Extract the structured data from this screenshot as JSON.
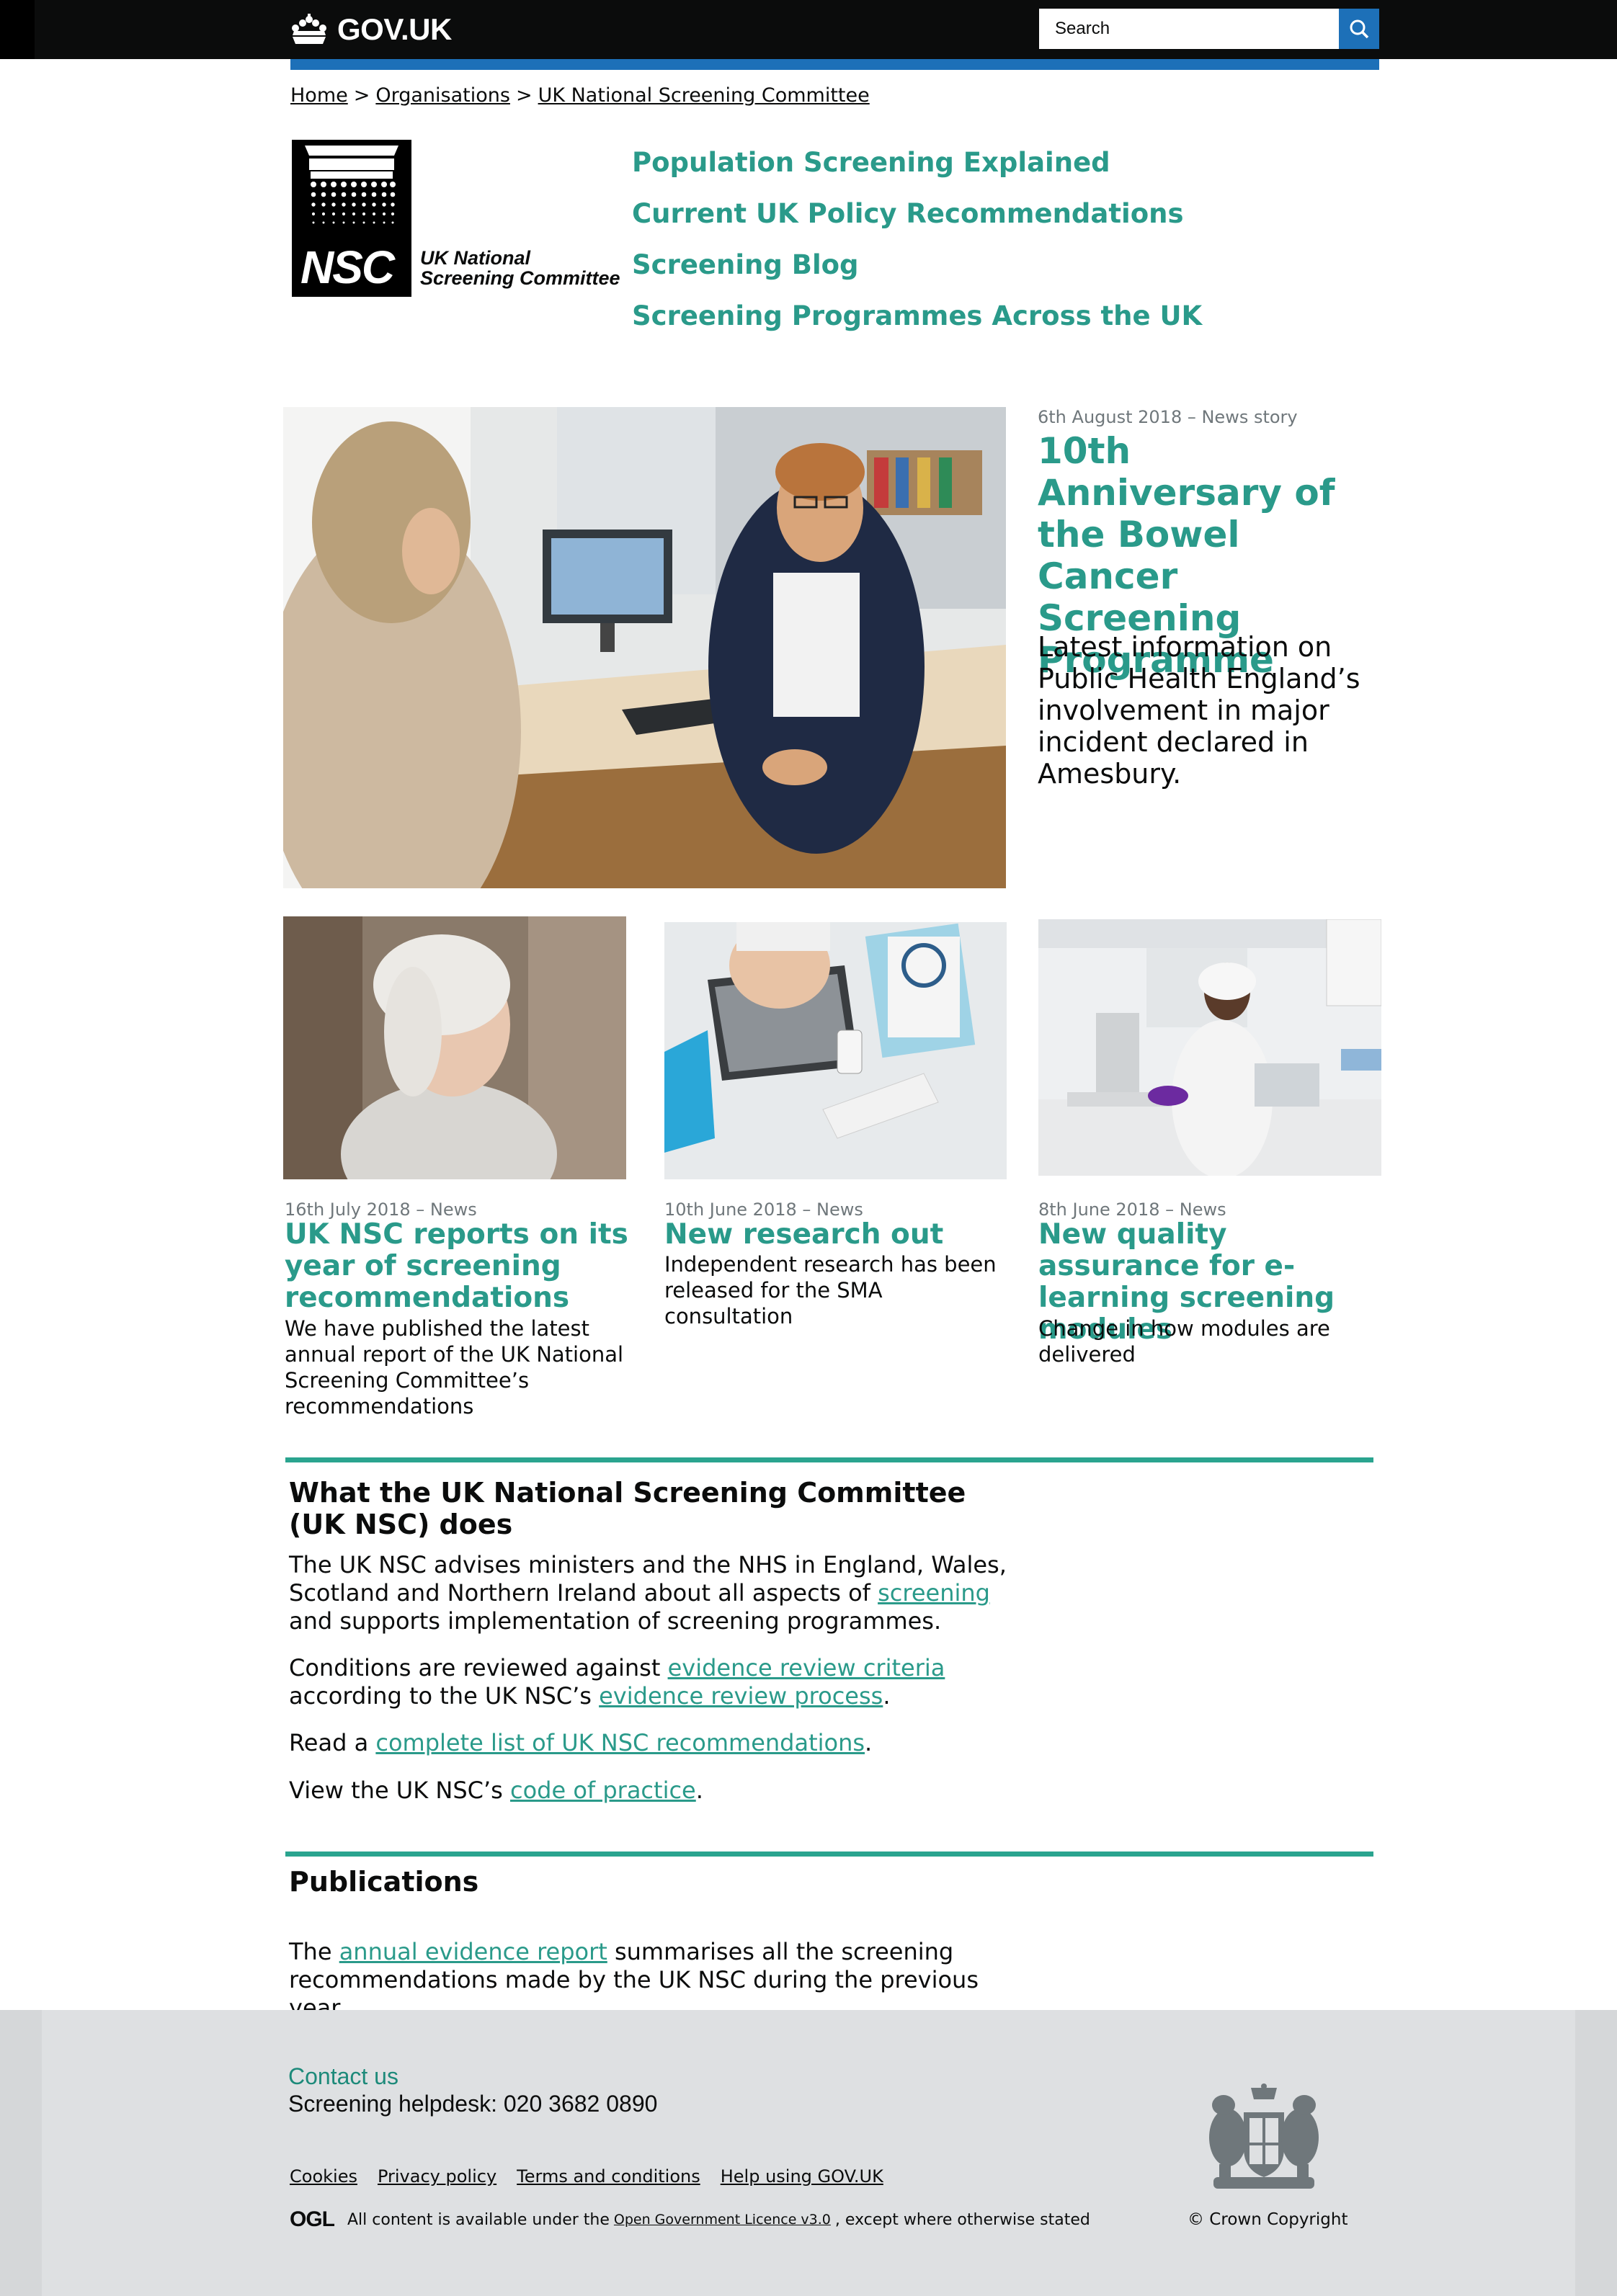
{
  "header": {
    "logo_text": "GOV.UK",
    "search_placeholder": "Search"
  },
  "breadcrumb": {
    "items": [
      "Home",
      "Organisations",
      "UK National Screening Committee"
    ],
    "separator": ">"
  },
  "nsc_logo": {
    "letters": "NSC",
    "line1": "UK National",
    "line2": "Screening Committee"
  },
  "top_nav": [
    "Population Screening Explained",
    "Current UK Policy Recommendations",
    "Screening Blog",
    "Screening Programmes Across the UK"
  ],
  "hero": {
    "meta": "6th August 2018 – News story",
    "title": "10th Anniversary of the Bowel Cancer Screening Programme",
    "description": "Latest information on Public Health England’s involvement in major incident declared in Amesbury."
  },
  "cards": [
    {
      "meta": "16th July 2018 – News",
      "title": "UK NSC reports on its year of screening recommendations",
      "description": "We have published the latest annual report of the UK National Screening Committee’s recommendations"
    },
    {
      "meta": "10th June 2018 – News",
      "title": "New research out",
      "description": "Independent research has been released for the SMA consultation"
    },
    {
      "meta": "8th June 2018 – News",
      "title": "New quality assurance for e-learning screening modules",
      "description": "Change in how modules are delivered"
    }
  ],
  "about": {
    "title": "What the UK National Screening Committee (UK NSC) does",
    "p1_before": "The UK NSC advises ministers and the NHS in England, Wales, Scotland and Northern Ireland about all aspects of ",
    "p1_link": "screening",
    "p1_after": " and supports implementation of screening programmes.",
    "p2_before": "Conditions are reviewed against ",
    "p2_link1": "evidence review criteria",
    "p2_middle": " according to the UK NSC’s ",
    "p2_link2": "evidence review process",
    "p2_after": ".",
    "p3_before": "Read a ",
    "p3_link": "complete list of UK NSC recommendations",
    "p3_after": ".",
    "p4_before": "View the UK NSC’s ",
    "p4_link": "code of practice",
    "p4_after": "."
  },
  "publications": {
    "title": "Publications",
    "p_before": "The ",
    "p_link": "annual evidence report",
    "p_after": " summarises all the screening recommendations made by the UK NSC during the previous year."
  },
  "footer": {
    "contact_title": "Contact us",
    "contact_phone": "Screening helpdesk: 020 3682 0890",
    "links": [
      "Cookies",
      "Privacy policy",
      "Terms and conditions",
      "Help using GOV.UK"
    ],
    "ogl_mark": "OGL",
    "licence_before": "All content is available under the",
    "licence_link": "Open Government Licence v3.0",
    "licence_after": ", except where otherwise stated",
    "copyright": "© Crown Copyright"
  },
  "colors": {
    "accent_teal": "#2a9a8a",
    "govuk_blue": "#1d70b8",
    "header_black": "#0b0c0c",
    "footer_grey": "#dee0e2"
  }
}
